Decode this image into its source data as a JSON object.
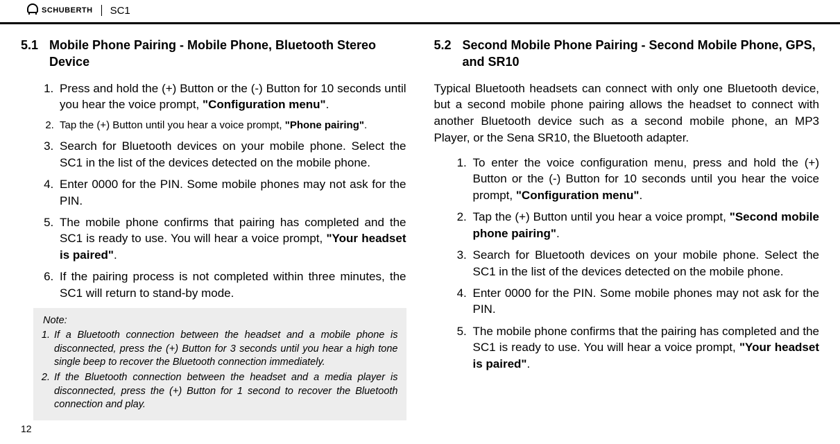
{
  "header": {
    "brand": "SCHUBERTH",
    "model": "SC1"
  },
  "left": {
    "num": "5.1",
    "title": "Mobile Phone Pairing - Mobile Phone, Bluetooth Stereo Device",
    "steps": [
      {
        "pre": "Press and hold the (+) Button or the (-) Button for 10 seconds until you hear the voice prompt, ",
        "bold": "\"Configuration menu\"",
        "post": "."
      },
      {
        "pre": "Tap the (+) Button until you hear a voice prompt, ",
        "bold": "\"Phone pairing\"",
        "post": ".",
        "small": true
      },
      {
        "pre": "Search for Bluetooth devices on your mobile phone. Select the SC1 in the list of the devices detected on the mobile phone."
      },
      {
        "pre": "Enter 0000 for the PIN. Some mobile phones may not ask for the PIN."
      },
      {
        "pre": "The mobile phone confirms that pairing has completed and the SC1 is ready to use. You will hear a voice prompt, ",
        "bold": "\"Your headset is paired\"",
        "post": "."
      },
      {
        "pre": "If the pairing process is not completed within three minutes, the SC1 will return to stand-by mode."
      }
    ],
    "note_title": "Note:",
    "notes": [
      "If a Bluetooth connection between the headset and a mobile phone is disconnected, press the (+) Button for 3 seconds until you hear a high tone single beep to recover the Bluetooth connection immediately.",
      "If the Bluetooth connection between the headset and a media player is disconnected, press the (+) Button for 1 second to recover the Bluetooth connection and play."
    ]
  },
  "right": {
    "num": "5.2",
    "title": "Second Mobile Phone Pairing - Second Mobile Phone, GPS, and SR10",
    "intro": "Typical Bluetooth headsets can connect with only one Bluetooth device, but a second mobile phone pairing allows the headset to connect with another Bluetooth device such as a second mobile phone, an MP3 Player, or the Sena SR10, the Bluetooth adapter.",
    "steps": [
      {
        "pre": "To enter the voice configuration menu, press and hold the (+) Button or the (-) Button for 10 seconds until you hear the voice prompt, ",
        "bold": "\"Configuration menu\"",
        "post": "."
      },
      {
        "pre": "Tap the (+) Button until you hear a voice prompt, ",
        "bold": "\"Second mobile phone pairing\"",
        "post": "."
      },
      {
        "pre": "Search for Bluetooth devices on your mobile phone. Select the SC1 in the list of the devices detected on the mobile phone."
      },
      {
        "pre": "Enter 0000 for the PIN. Some mobile phones may not ask for the PIN."
      },
      {
        "pre": "The mobile phone confirms that the pairing has completed and the SC1 is ready to use. You will hear a voice prompt, ",
        "bold": "\"Your headset is paired\"",
        "post": "."
      }
    ]
  },
  "page": "12"
}
